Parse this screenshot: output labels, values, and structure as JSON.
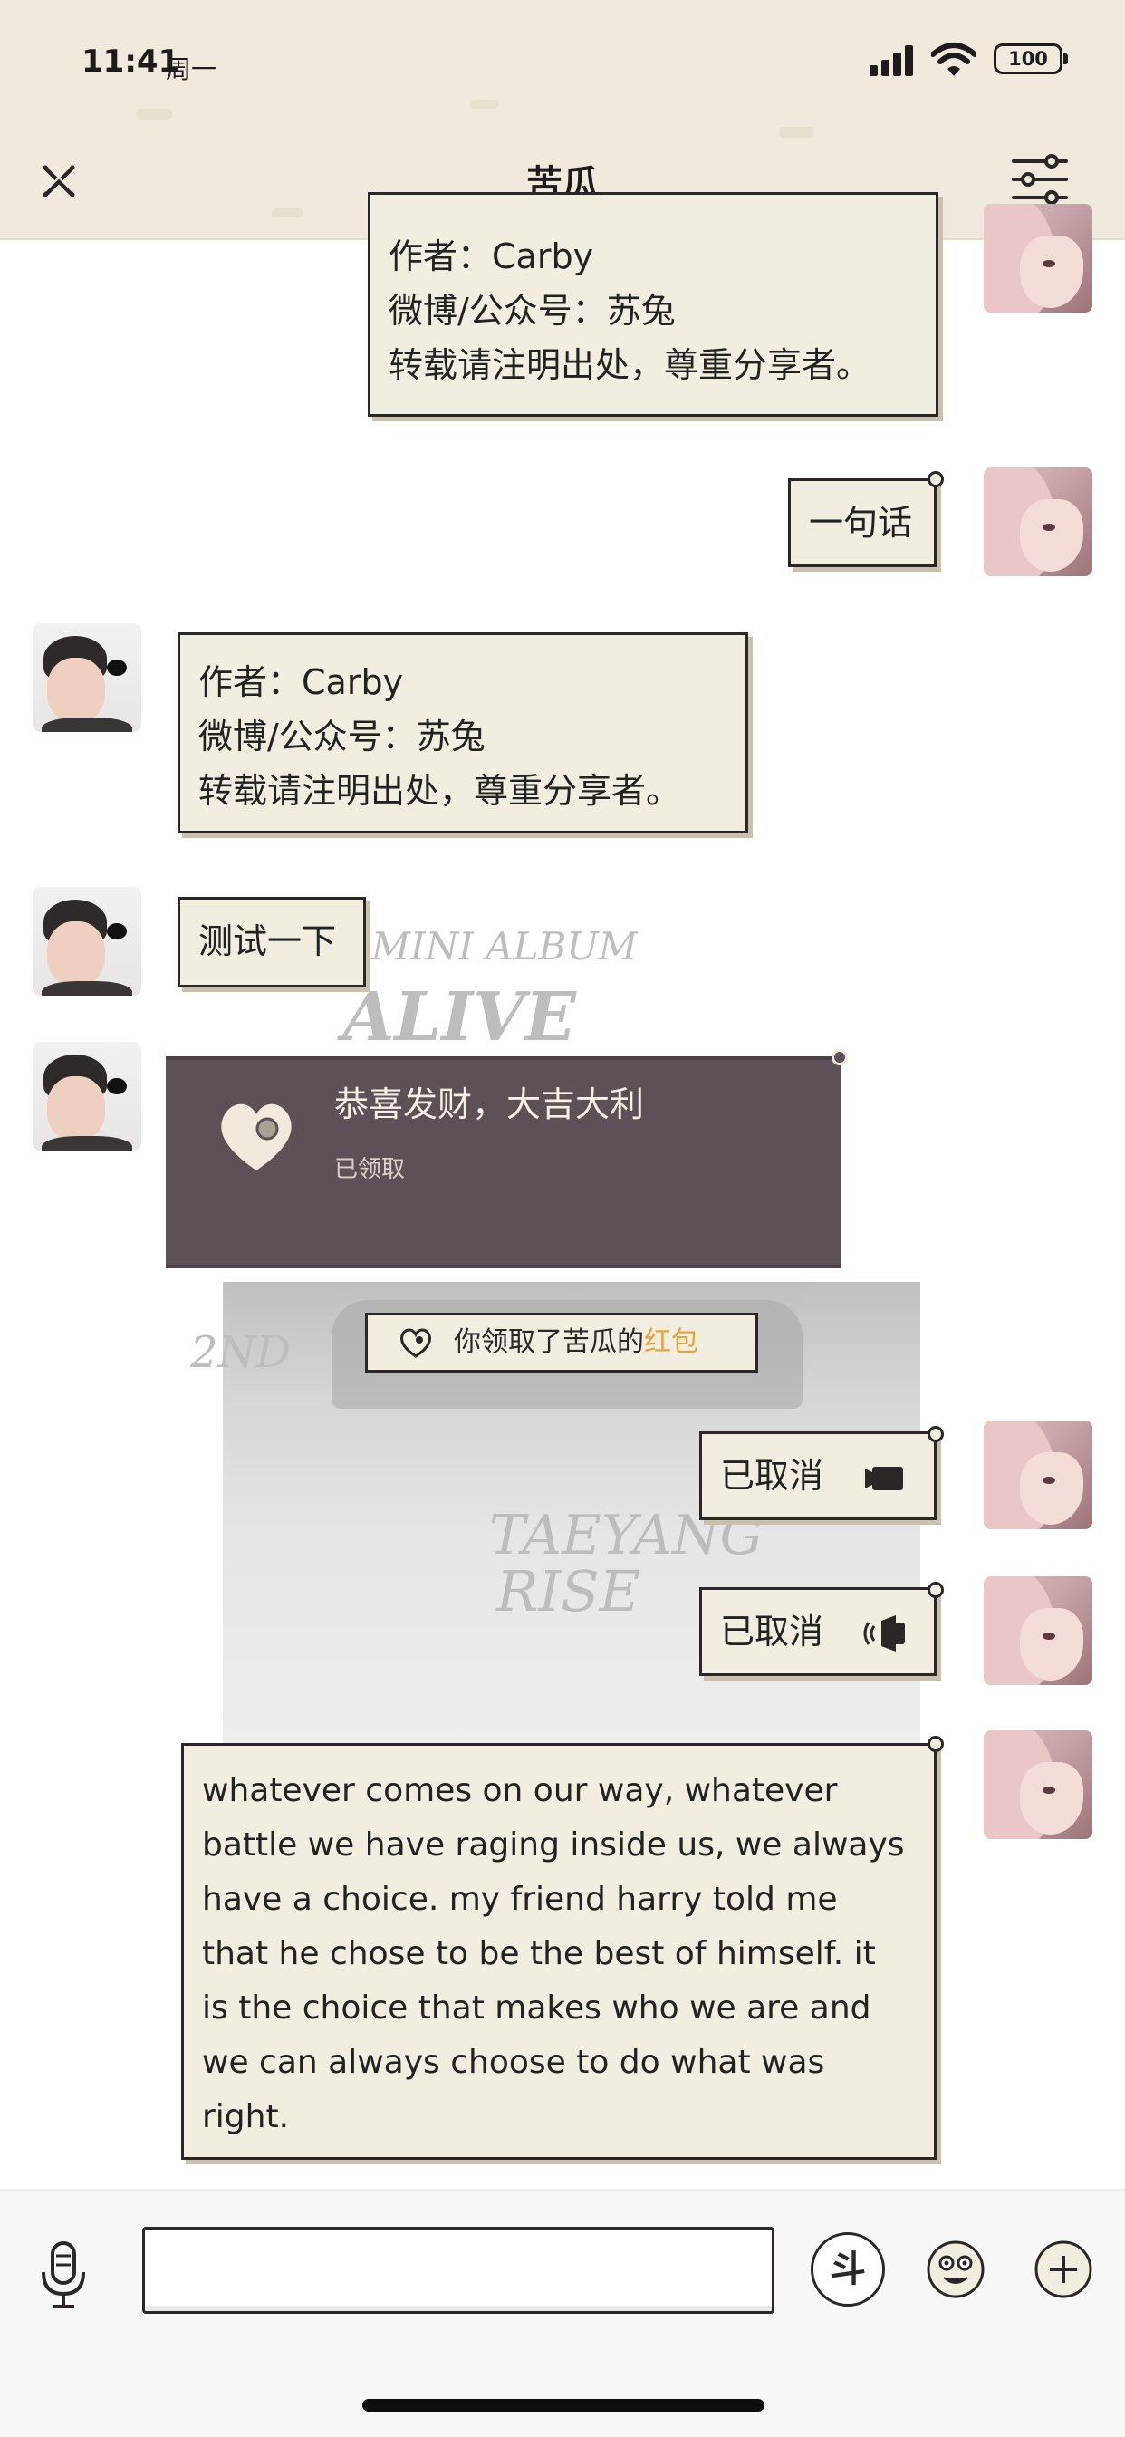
{
  "status_bar": {
    "time": "11:41",
    "day": "周一",
    "battery": "100"
  },
  "nav": {
    "title": "苦瓜",
    "close_icon": "close-x-icon",
    "menu_icon": "sliders-icon"
  },
  "background_text": [
    "MINI ALBUM",
    "ALIVE",
    "TAEYANG",
    "RISE",
    "2ND"
  ],
  "messages": [
    {
      "side": "right",
      "type": "text",
      "lines": [
        "作者：Carby",
        "微博/公众号：苏兔",
        "转载请注明出处，尊重分享者。"
      ]
    },
    {
      "side": "right",
      "type": "text",
      "lines": [
        "一句话"
      ]
    },
    {
      "side": "left",
      "type": "text",
      "lines": [
        "作者：Carby",
        "微博/公众号：苏兔",
        "转载请注明出处，尊重分享者。"
      ]
    },
    {
      "side": "left",
      "type": "text",
      "lines": [
        "测试一下"
      ]
    },
    {
      "side": "left",
      "type": "red_packet",
      "title": "恭喜发财，大吉大利",
      "status": "已领取"
    },
    {
      "side": "center",
      "type": "notice",
      "text": "你领取了苦瓜的",
      "highlight": "红包",
      "highlight_color": "#e7a13b"
    },
    {
      "side": "right",
      "type": "call",
      "text": "已取消",
      "icon": "video-camera-icon"
    },
    {
      "side": "right",
      "type": "call",
      "text": "已取消",
      "icon": "voice-call-icon"
    },
    {
      "side": "right",
      "type": "text",
      "lines": [
        "whatever comes on our way, whatever",
        "battle we have raging inside us, we always",
        "have a choice. my friend harry told me",
        "that he chose to be the best of himself. it",
        "is the choice that makes who we are and",
        "we can always choose to do what was",
        "right."
      ]
    }
  ],
  "input_bar": {
    "placeholder": "",
    "dou_label": "斗",
    "icons": [
      "microphone-icon",
      "emoji-icon",
      "plus-icon"
    ]
  },
  "colors": {
    "bubble": "#f1eddf",
    "border": "#2b2628",
    "header": "#efeadb",
    "red_packet": "#5c5156"
  }
}
